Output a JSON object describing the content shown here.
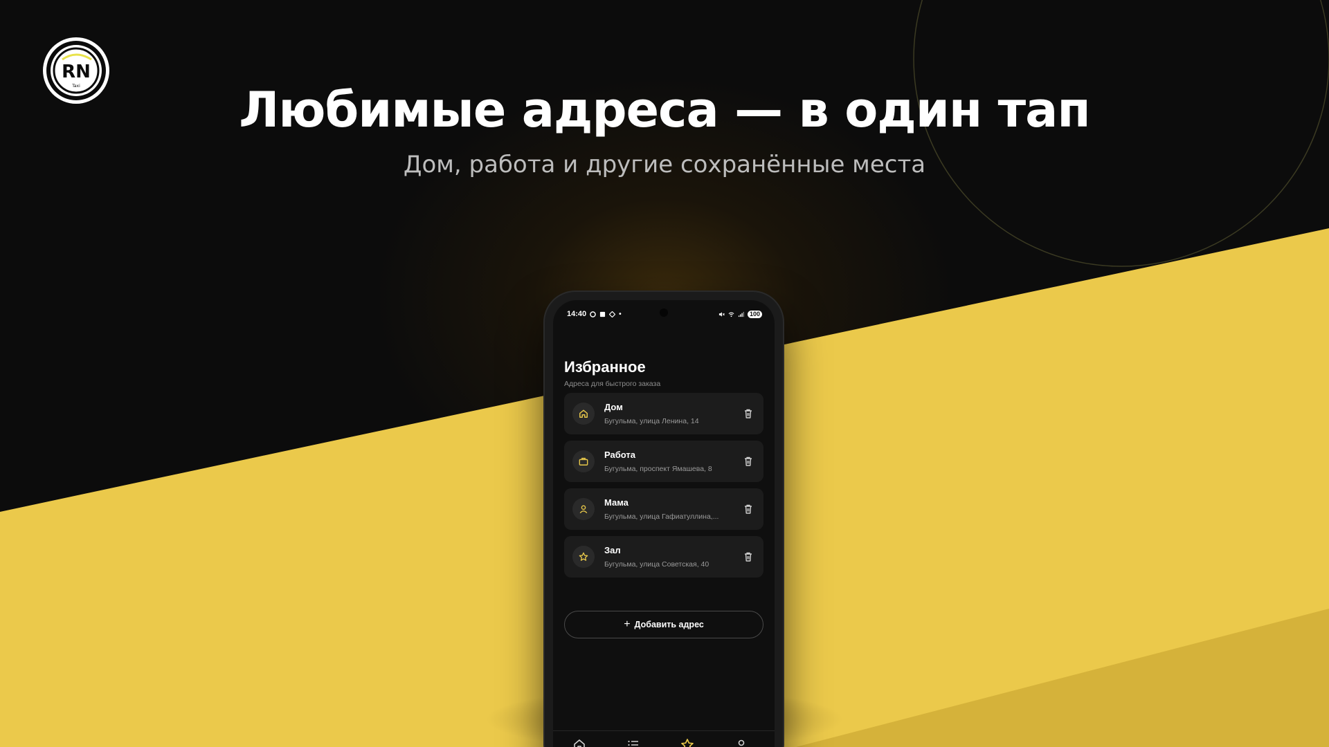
{
  "colors": {
    "accent": "#e8c84a",
    "background": "#0c0c0c",
    "yellow_panel": "#ebc94b",
    "card": "#1c1c1c"
  },
  "hero": {
    "title": "Любимые адреса — в один тап",
    "subtitle": "Дом, работа и другие сохранённые места"
  },
  "logo": {
    "letters": "RN",
    "small": "Taxi"
  },
  "phone": {
    "status_bar": {
      "time": "14:40",
      "battery": "100",
      "icons": [
        "message-icon",
        "task-icon",
        "diamond-icon",
        "mute-icon",
        "wifi-icon",
        "signal-icon"
      ]
    },
    "page": {
      "title": "Избранное",
      "subtitle": "Адреса для быстрого заказа"
    },
    "favorites": [
      {
        "name": "Дом",
        "address": "Бугульма, улица Ленина, 14",
        "icon": "home-icon"
      },
      {
        "name": "Работа",
        "address": "Бугульма, проспект Ямашева, 8",
        "icon": "briefcase-icon"
      },
      {
        "name": "Мама",
        "address": "Бугульма, улица Гафиатуллина,...",
        "icon": "person-icon"
      },
      {
        "name": "Зал",
        "address": "Бугульма, улица Советская, 40",
        "icon": "star-icon"
      }
    ],
    "add_button": {
      "label": "Добавить адрес",
      "icon": "plus-icon"
    },
    "tabbar": {
      "active": "favorites",
      "tabs": [
        {
          "id": "home",
          "icon": "home-icon",
          "label": ""
        },
        {
          "id": "list",
          "icon": "list-icon",
          "label": ""
        },
        {
          "id": "favorites",
          "icon": "star-icon",
          "label": ""
        },
        {
          "id": "profile",
          "icon": "person-icon",
          "label": ""
        }
      ]
    }
  }
}
